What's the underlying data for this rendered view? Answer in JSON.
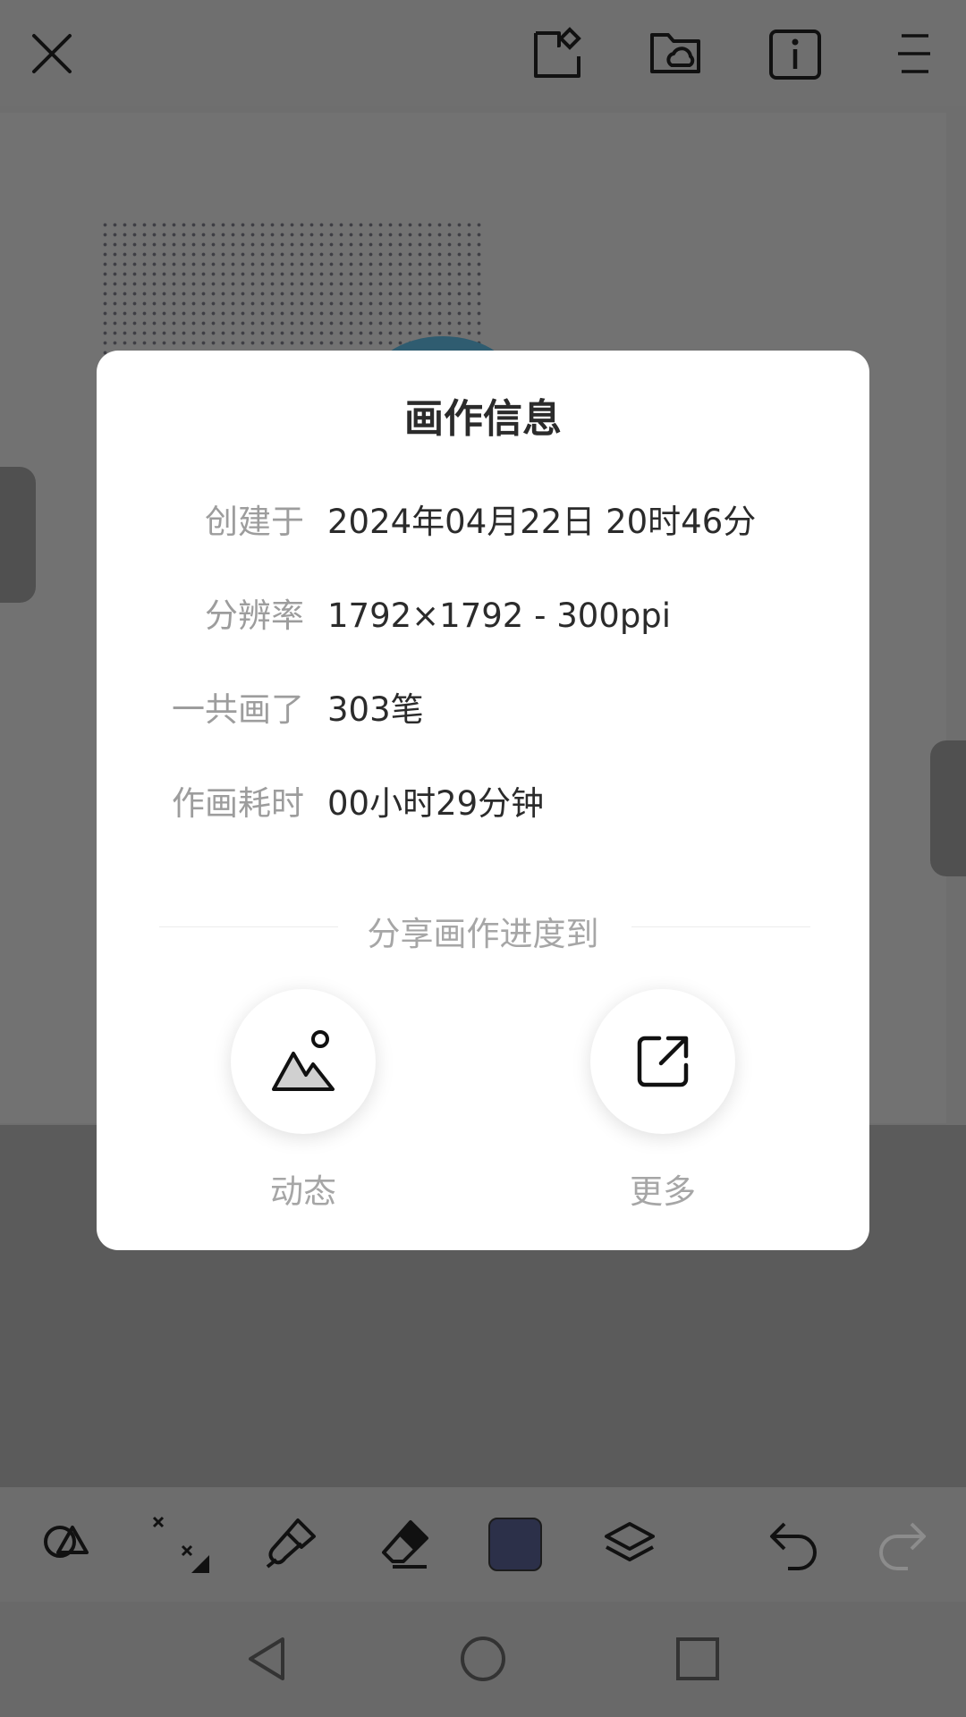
{
  "top_bar": {
    "icons": [
      "close-icon",
      "shapes-edit-icon",
      "cloud-folder-icon",
      "info-icon",
      "menu-icon"
    ]
  },
  "dialog": {
    "title": "画作信息",
    "info": {
      "created": {
        "label": "创建于",
        "value": "2024年04月22日 20时46分"
      },
      "resolution": {
        "label": "分辨率",
        "value": "1792×1792 - 300ppi"
      },
      "strokes": {
        "label": "一共画了",
        "value": "303笔"
      },
      "duration": {
        "label": "作画耗时",
        "value": "00小时29分钟"
      }
    },
    "share": {
      "title": "分享画作进度到",
      "options": [
        {
          "label": "动态",
          "icon": "image-mountain-icon"
        },
        {
          "label": "更多",
          "icon": "external-share-icon"
        }
      ]
    }
  },
  "bottom_toolbar": {
    "icons": [
      "shapes-icon",
      "symmetry-icon",
      "brush-icon",
      "eraser-icon",
      "color-swatch",
      "layers-icon",
      "undo-icon",
      "redo-icon"
    ],
    "current_color": "#2c3049"
  },
  "nav_bar": {
    "icons": [
      "back-icon",
      "home-icon",
      "recents-icon"
    ]
  }
}
